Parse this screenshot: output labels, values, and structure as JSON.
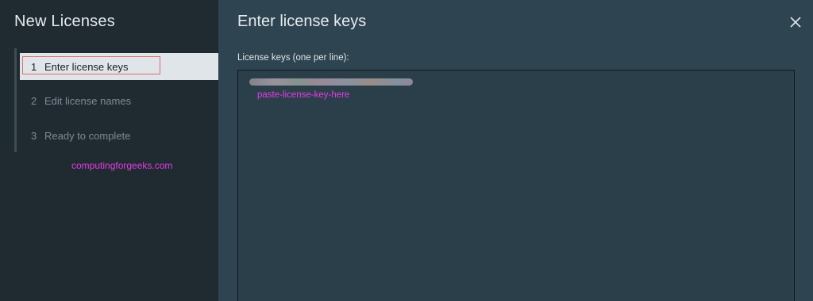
{
  "wizard": {
    "title": "New Licenses"
  },
  "steps": [
    {
      "number": "1",
      "label": "Enter license keys",
      "active": true
    },
    {
      "number": "2",
      "label": "Edit license names",
      "active": false
    },
    {
      "number": "3",
      "label": "Ready to complete",
      "active": false
    }
  ],
  "watermark": "computingforgeeks.com",
  "page": {
    "title": "Enter license keys",
    "close_icon": "close-icon"
  },
  "license_field": {
    "label": "License keys (one per line):",
    "annotation": "paste-license-key-here"
  },
  "colors": {
    "left_panel_bg": "#1f2a31",
    "right_panel_bg": "#2f4451",
    "active_step_bg": "#dfe5e8",
    "highlight_border": "#e06b6b",
    "annotation_color": "#e43ce4"
  }
}
